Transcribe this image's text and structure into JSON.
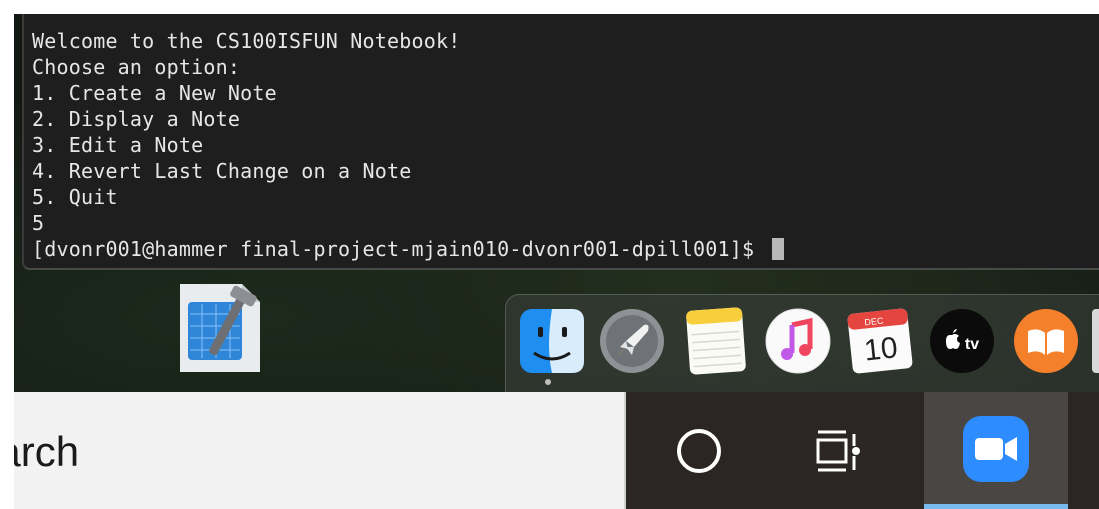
{
  "terminal": {
    "lines": [
      "Welcome to the CS100ISFUN Notebook!",
      "Choose an option:",
      "1. Create a New Note",
      "2. Display a Note",
      "3. Edit a Note",
      "4. Revert Last Change on a Note",
      "5. Quit",
      "5",
      "[dvonr001@hammer final-project-mjain010-dvonr001-dpill001]$ "
    ]
  },
  "desktop": {
    "icons": [
      "xcode-icon"
    ]
  },
  "dock": {
    "apps": [
      {
        "name": "finder-icon"
      },
      {
        "name": "launchpad-icon"
      },
      {
        "name": "notes-icon"
      },
      {
        "name": "music-icon"
      },
      {
        "name": "calendar-icon",
        "month": "DEC",
        "day": "10"
      },
      {
        "name": "apple-tv-icon",
        "label": "tv"
      },
      {
        "name": "books-icon"
      }
    ]
  },
  "taskbar": {
    "search_text": "earch",
    "buttons": [
      "cortana-icon",
      "task-view-icon",
      "zoom-icon"
    ],
    "colors": {
      "zoom": "#2d8cff",
      "active_underline": "#76b9ed"
    }
  }
}
